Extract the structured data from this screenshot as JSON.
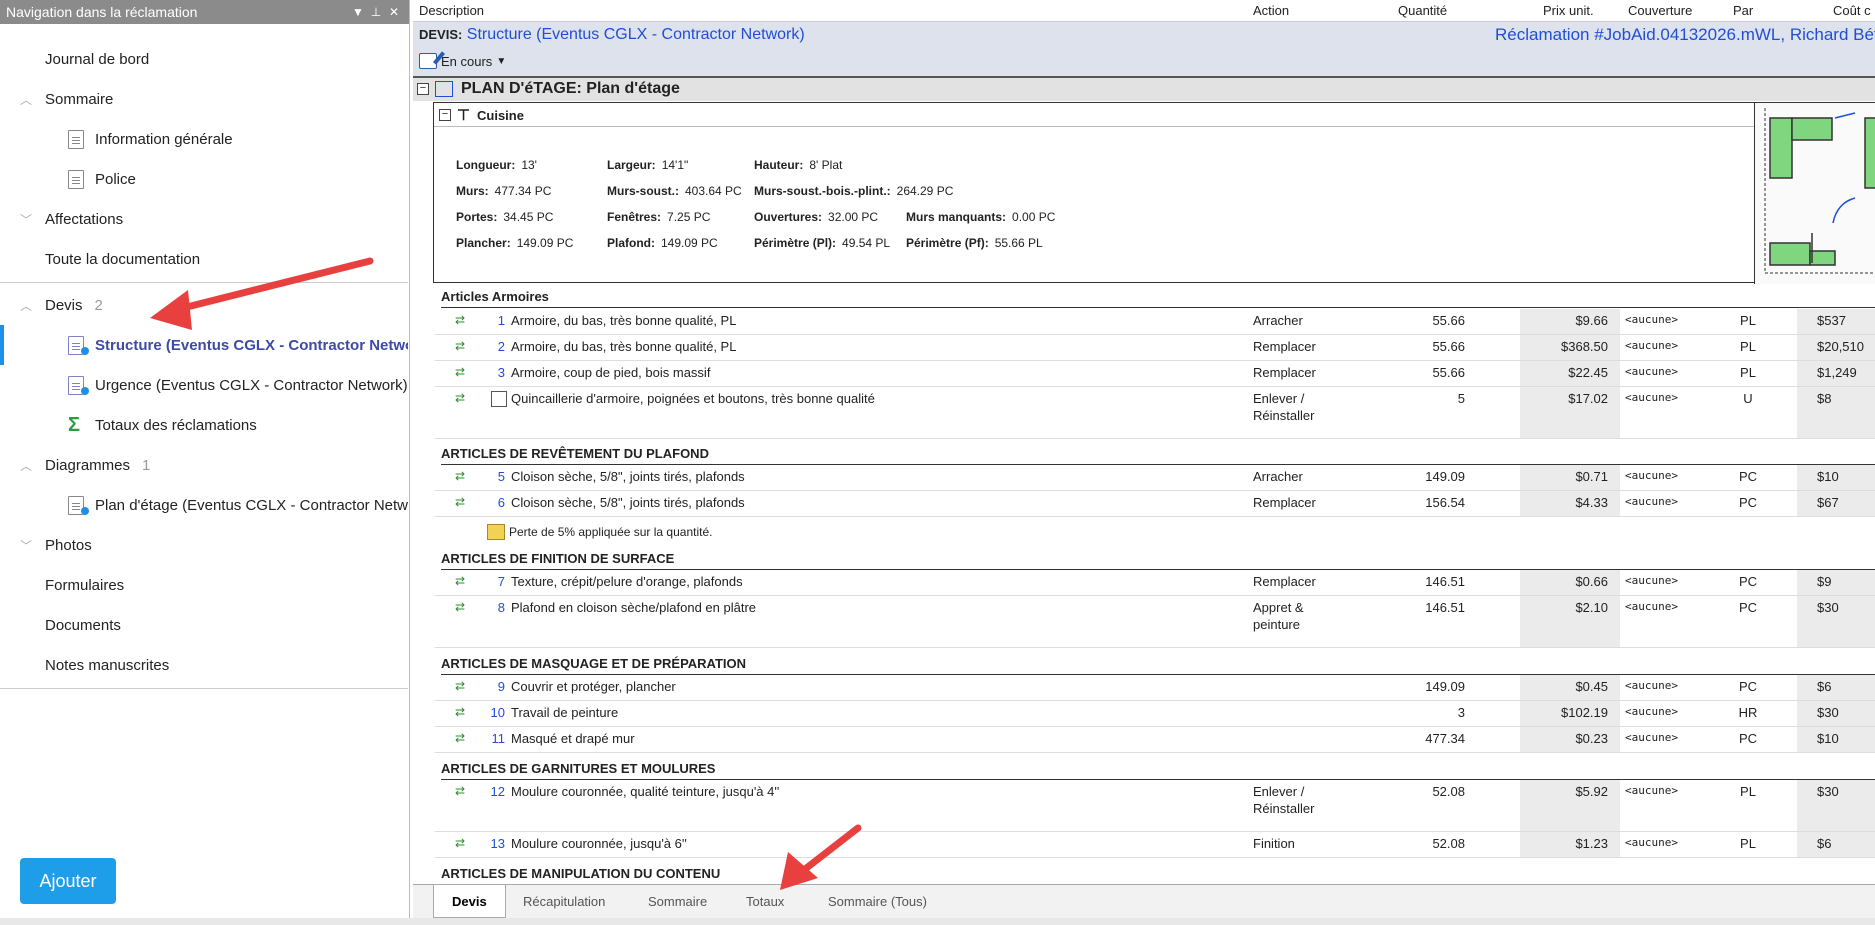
{
  "nav": {
    "header_title": "Navigation dans la réclamation",
    "items": [
      {
        "label": "Journal de bord"
      },
      {
        "label": "Sommaire"
      },
      {
        "label": "Information générale"
      },
      {
        "label": "Police"
      },
      {
        "label": "Affectations"
      },
      {
        "label": "Toute la documentation"
      },
      {
        "label": "Devis",
        "count": "2"
      },
      {
        "label": "Structure (Eventus CGLX - Contractor Network)"
      },
      {
        "label": "Urgence (Eventus CGLX - Contractor Network)"
      },
      {
        "label": "Totaux des réclamations"
      },
      {
        "label": "Diagrammes",
        "count": "1"
      },
      {
        "label": "Plan d'étage (Eventus CGLX - Contractor Network)"
      },
      {
        "label": "Photos"
      },
      {
        "label": "Formulaires"
      },
      {
        "label": "Documents"
      },
      {
        "label": "Notes manuscrites"
      }
    ],
    "add_button": "Ajouter"
  },
  "columns": {
    "description": "Description",
    "action": "Action",
    "quantity": "Quantité",
    "unit_price": "Prix unit.",
    "coverage": "Couverture",
    "per": "Par",
    "cost": "Coût c"
  },
  "estimate": {
    "prefix": "DEVIS:",
    "name": "Structure (Eventus CGLX - Contractor Network)",
    "claim": "Réclamation #JobAid.04132026.mWL, Richard Bét",
    "status": "En cours"
  },
  "plan": {
    "title": "PLAN D'éTAGE: Plan d'étage",
    "room": "Cuisine",
    "stats": [
      {
        "k": "Longueur:",
        "v": "13'"
      },
      {
        "k": "Largeur:",
        "v": "14'1\""
      },
      {
        "k": "Hauteur:",
        "v": "8' Plat"
      },
      {
        "k": "Murs:",
        "v": "477.34 PC"
      },
      {
        "k": "Murs-soust.:",
        "v": "403.64 PC"
      },
      {
        "k": "Murs-soust.-bois.-plint.:",
        "v": "264.29 PC"
      },
      {
        "k": "Portes:",
        "v": "34.45 PC"
      },
      {
        "k": "Fenêtres:",
        "v": "7.25 PC"
      },
      {
        "k": "Ouvertures:",
        "v": "32.00 PC"
      },
      {
        "k": "Murs manquants:",
        "v": "0.00 PC"
      },
      {
        "k": "Plancher:",
        "v": "149.09 PC"
      },
      {
        "k": "Plafond:",
        "v": "149.09 PC"
      },
      {
        "k": "Périmètre (Pl):",
        "v": "49.54 PL"
      },
      {
        "k": "Périmètre (Pf):",
        "v": "55.66 PL"
      }
    ]
  },
  "groups": [
    "Articles Armoires",
    "ARTICLES DE REVÊTEMENT DU PLAFOND",
    "ARTICLES DE FINITION DE SURFACE",
    "ARTICLES DE MASQUAGE ET DE PRÉPARATION",
    "ARTICLES DE GARNITURES ET MOULURES",
    "ARTICLES DE MANIPULATION DU CONTENU"
  ],
  "rows": [
    {
      "num": "1",
      "desc": "Armoire, du bas, très bonne qualité, PL",
      "action": "Arracher",
      "action2": "",
      "qty": "55.66",
      "price": "$9.66",
      "cov": "<aucune>",
      "unit": "PL",
      "cost": "$537"
    },
    {
      "num": "2",
      "desc": "Armoire, du bas, très bonne qualité, PL",
      "action": "Remplacer",
      "action2": "",
      "qty": "55.66",
      "price": "$368.50",
      "cov": "<aucune>",
      "unit": "PL",
      "cost": "$20,510"
    },
    {
      "num": "3",
      "desc": "Armoire, coup de pied, bois massif",
      "action": "Remplacer",
      "action2": "",
      "qty": "55.66",
      "price": "$22.45",
      "cov": "<aucune>",
      "unit": "PL",
      "cost": "$1,249"
    },
    {
      "num": "",
      "desc": "Quincaillerie d'armoire, poignées et boutons, très bonne qualité",
      "action": "Enlever /",
      "action2": "Réinstaller",
      "qty": "5",
      "price": "$17.02",
      "cov": "<aucune>",
      "unit": "U",
      "cost": "$8"
    },
    {
      "num": "5",
      "desc": "Cloison sèche, 5/8\", joints tirés, plafonds",
      "action": "Arracher",
      "action2": "",
      "qty": "149.09",
      "price": "$0.71",
      "cov": "<aucune>",
      "unit": "PC",
      "cost": "$10"
    },
    {
      "num": "6",
      "desc": "Cloison sèche, 5/8\", joints tirés, plafonds",
      "action": "Remplacer",
      "action2": "",
      "qty": "156.54",
      "price": "$4.33",
      "cov": "<aucune>",
      "unit": "PC",
      "cost": "$67"
    },
    {
      "num": "7",
      "desc": "Texture, crépit/pelure d'orange, plafonds",
      "action": "Remplacer",
      "action2": "",
      "qty": "146.51",
      "price": "$0.66",
      "cov": "<aucune>",
      "unit": "PC",
      "cost": "$9"
    },
    {
      "num": "8",
      "desc": "Plafond en cloison sèche/plafond en plâtre",
      "action": "Appret &",
      "action2": "peinture",
      "qty": "146.51",
      "price": "$2.10",
      "cov": "<aucune>",
      "unit": "PC",
      "cost": "$30"
    },
    {
      "num": "9",
      "desc": "Couvrir et protéger, plancher",
      "action": "",
      "action2": "",
      "qty": "149.09",
      "price": "$0.45",
      "cov": "<aucune>",
      "unit": "PC",
      "cost": "$6"
    },
    {
      "num": "10",
      "desc": "Travail de peinture",
      "action": "",
      "action2": "",
      "qty": "3",
      "price": "$102.19",
      "cov": "<aucune>",
      "unit": "HR",
      "cost": "$30"
    },
    {
      "num": "11",
      "desc": "Masqué et drapé mur",
      "action": "",
      "action2": "",
      "qty": "477.34",
      "price": "$0.23",
      "cov": "<aucune>",
      "unit": "PC",
      "cost": "$10"
    },
    {
      "num": "12",
      "desc": "Moulure couronnée, qualité teinture, jusqu'à 4''",
      "action": "Enlever /",
      "action2": "Réinstaller",
      "qty": "52.08",
      "price": "$5.92",
      "cov": "<aucune>",
      "unit": "PL",
      "cost": "$30"
    },
    {
      "num": "13",
      "desc": "Moulure couronnée, jusqu'à 6''",
      "action": "Finition",
      "action2": "",
      "qty": "52.08",
      "price": "$1.23",
      "cov": "<aucune>",
      "unit": "PL",
      "cost": "$6"
    }
  ],
  "note": "Perte de 5% appliquée sur la quantité.",
  "tabs": [
    "Devis",
    "Récapitulation",
    "Sommaire",
    "Totaux",
    "Sommaire (Tous)"
  ],
  "colors": {
    "accent": "#1e90e8",
    "link": "#1f4fd6",
    "arrow": "#e8403f",
    "header_bg": "#dde2ec"
  }
}
